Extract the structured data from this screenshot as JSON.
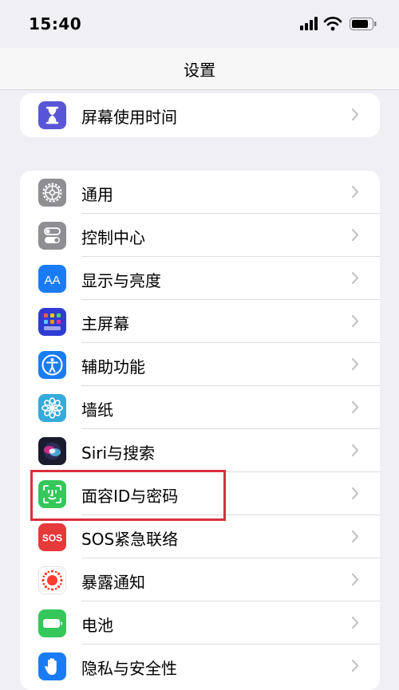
{
  "status_bar": {
    "time": "15:40"
  },
  "nav": {
    "title": "设置"
  },
  "group1": [
    {
      "label": "屏幕使用时间",
      "icon": "hourglass-icon",
      "color": "#5856d6"
    }
  ],
  "group2": [
    {
      "label": "通用",
      "icon": "gear-icon",
      "color": "#8e8e93"
    },
    {
      "label": "控制中心",
      "icon": "toggles-icon",
      "color": "#8e8e93"
    },
    {
      "label": "显示与亮度",
      "icon": "text-size-icon",
      "icon_text": "AA",
      "color": "#1a7cf5"
    },
    {
      "label": "主屏幕",
      "icon": "app-grid-icon",
      "color": "#2f3bd3"
    },
    {
      "label": "辅助功能",
      "icon": "accessibility-icon",
      "color": "#1a7cf5"
    },
    {
      "label": "墙纸",
      "icon": "flower-icon",
      "color": "#35aadc"
    },
    {
      "label": "Siri与搜索",
      "icon": "siri-icon",
      "color": "#1b1b2e"
    },
    {
      "label": "面容ID与密码",
      "icon": "face-id-icon",
      "color": "#34c759"
    },
    {
      "label": "SOS紧急联络",
      "icon": "sos-icon",
      "icon_text": "SOS",
      "color": "#e5393b"
    },
    {
      "label": "暴露通知",
      "icon": "exposure-icon",
      "color": "#ffffff"
    },
    {
      "label": "电池",
      "icon": "battery-icon",
      "color": "#34c759"
    },
    {
      "label": "隐私与安全性",
      "icon": "hand-icon",
      "color": "#1a7cf5"
    }
  ],
  "highlight_color": "#dc2e3d"
}
